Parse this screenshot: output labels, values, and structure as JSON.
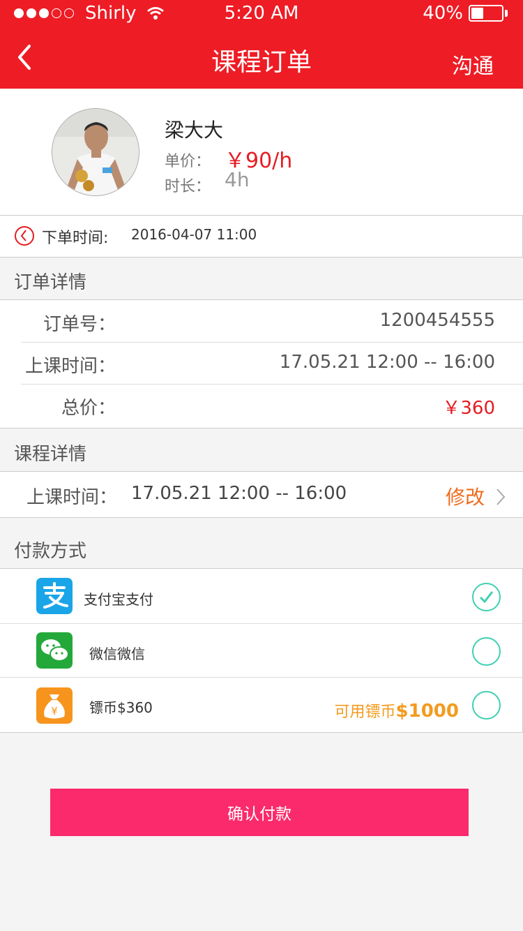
{
  "status": {
    "carrier": "Shirly",
    "time": "5:20 AM",
    "battery": "40%",
    "battery_level": 0.4,
    "signal_bars": 3
  },
  "nav": {
    "title": "课程订单",
    "right": "沟通"
  },
  "profile": {
    "name": "梁大大",
    "price_label": "单价：",
    "price": "￥90/h",
    "duration_label": "时长：",
    "duration": "4h"
  },
  "order_time": {
    "label": "下单时间:",
    "value": "2016-04-07   11:00"
  },
  "order_details": {
    "title": "订单详情",
    "rows": [
      {
        "label": "订单号：",
        "value": "1200454555"
      },
      {
        "label": "上课时间：",
        "value": "17.05.21  12:00 -- 16:00"
      },
      {
        "label": "总价：",
        "value": "￥360"
      }
    ]
  },
  "course_details": {
    "title": "课程详情",
    "label": "上课时间：",
    "value": "17.05.21  12:00 -- 16:00",
    "action": "修改"
  },
  "payment": {
    "title": "付款方式",
    "methods": [
      {
        "label": "支付宝支付",
        "icon": "alipay-icon",
        "selected": true
      },
      {
        "label": "微信微信",
        "icon": "wechat-icon",
        "selected": false
      },
      {
        "label": "镖币$360",
        "icon": "coin-bag-icon",
        "selected": false,
        "available_prefix": "可用镖币",
        "available_amount": "$1000"
      }
    ]
  },
  "colors": {
    "header": "#ee1c25",
    "accent_red": "#e51c23",
    "confirm": "#fb2a6c",
    "radio": "#3fd0b2",
    "orange": "#f39b1f"
  },
  "confirm_label": "确认付款"
}
